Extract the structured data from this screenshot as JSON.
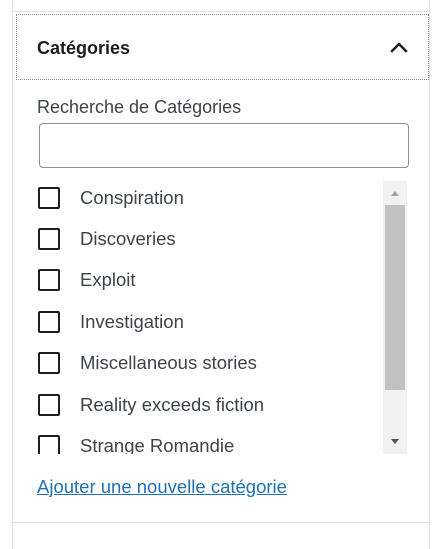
{
  "panel": {
    "title": "Catégories",
    "toggle_icon": "chevron-up-icon",
    "expanded": true
  },
  "search": {
    "label": "Recherche de Catégories",
    "value": "",
    "placeholder": ""
  },
  "categories": [
    {
      "label": "Conspiration",
      "checked": false
    },
    {
      "label": "Discoveries",
      "checked": false
    },
    {
      "label": "Exploit",
      "checked": false
    },
    {
      "label": "Investigation",
      "checked": false
    },
    {
      "label": "Miscellaneous stories",
      "checked": false
    },
    {
      "label": "Reality exceeds fiction",
      "checked": false
    },
    {
      "label": "Strange Romandie",
      "checked": false
    }
  ],
  "scrollbar": {
    "up_icon": "scroll-up-arrow-icon",
    "down_icon": "scroll-down-arrow-icon"
  },
  "add_link": {
    "label": "Ajouter une nouvelle catégorie"
  },
  "colors": {
    "link": "#2271b1",
    "text": "#3c434a",
    "border": "#8c8f94"
  }
}
